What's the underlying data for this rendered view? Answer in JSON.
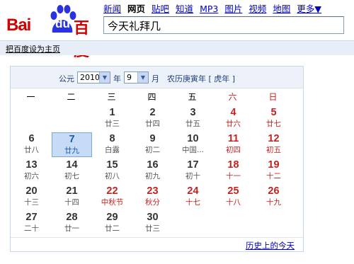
{
  "logo": {
    "text_left": "Bai",
    "text_mid": "du",
    "text_right": "百度",
    "color": "#d40000"
  },
  "nav": {
    "items": [
      {
        "label": "新闻",
        "active": false
      },
      {
        "label": "网页",
        "active": true
      },
      {
        "label": "贴吧",
        "active": false
      },
      {
        "label": "知道",
        "active": false
      },
      {
        "label": "MP3",
        "active": false
      },
      {
        "label": "图片",
        "active": false
      },
      {
        "label": "视频",
        "active": false
      },
      {
        "label": "地图",
        "active": false
      }
    ],
    "more_label": "更多▼"
  },
  "search": {
    "value": "今天礼拜几"
  },
  "homepage_link": "把百度设为主页",
  "calendar": {
    "label_gongyuan": "公元",
    "year_value": "2010",
    "label_year": "年",
    "month_value": "9",
    "label_month": "月",
    "lunar_year": "农历庚寅年 [ 虎年 ]",
    "weekdays": [
      "一",
      "二",
      "三",
      "四",
      "五",
      "六",
      "日"
    ],
    "weeks": [
      [
        null,
        null,
        {
          "d": "1",
          "l": "廿三"
        },
        {
          "d": "2",
          "l": "廿四"
        },
        {
          "d": "3",
          "l": "廿五"
        },
        {
          "d": "4",
          "l": "廿六",
          "style": "red"
        },
        {
          "d": "5",
          "l": "廿七",
          "style": "red"
        }
      ],
      [
        {
          "d": "6",
          "l": "廿八"
        },
        {
          "d": "7",
          "l": "廿九",
          "style": "today"
        },
        {
          "d": "8",
          "l": "白露"
        },
        {
          "d": "9",
          "l": "初二"
        },
        {
          "d": "10",
          "l": "中国..."
        },
        {
          "d": "11",
          "l": "初四",
          "style": "red"
        },
        {
          "d": "12",
          "l": "初五",
          "style": "red"
        }
      ],
      [
        {
          "d": "13",
          "l": "初六"
        },
        {
          "d": "14",
          "l": "初七"
        },
        {
          "d": "15",
          "l": "初八"
        },
        {
          "d": "16",
          "l": "初九"
        },
        {
          "d": "17",
          "l": "初十"
        },
        {
          "d": "18",
          "l": "十一",
          "style": "red"
        },
        {
          "d": "19",
          "l": "十二",
          "style": "red"
        }
      ],
      [
        {
          "d": "20",
          "l": "十三"
        },
        {
          "d": "21",
          "l": "十四"
        },
        {
          "d": "22",
          "l": "中秋节",
          "style": "red"
        },
        {
          "d": "23",
          "l": "秋分",
          "style": "red"
        },
        {
          "d": "24",
          "l": "十七",
          "style": "red"
        },
        {
          "d": "25",
          "l": "十八",
          "style": "red"
        },
        {
          "d": "26",
          "l": "十九",
          "style": "red"
        }
      ],
      [
        {
          "d": "27",
          "l": "二十"
        },
        {
          "d": "28",
          "l": "廿一"
        },
        {
          "d": "29",
          "l": "廿二"
        },
        {
          "d": "30",
          "l": "廿三"
        },
        null,
        null,
        null
      ]
    ],
    "history_link": "历史上的今天",
    "accent_red": "#c8201c",
    "today_bg": "#c5dbf6"
  }
}
